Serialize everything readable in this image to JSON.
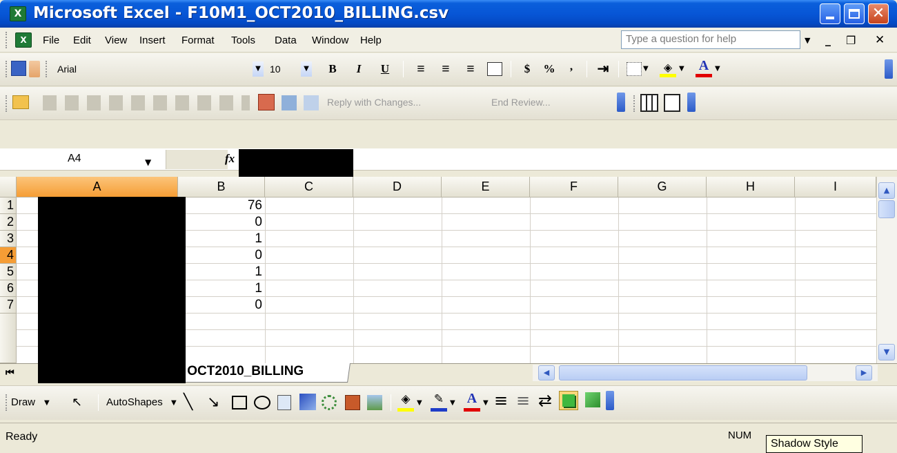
{
  "window": {
    "title": "Microsoft Excel - F10M1_OCT2010_BILLING.csv"
  },
  "menubar": {
    "items": [
      "File",
      "Edit",
      "View",
      "Insert",
      "Format",
      "Tools",
      "Data",
      "Window",
      "Help"
    ],
    "help_placeholder": "Type a question for help"
  },
  "formatting": {
    "font": "Arial",
    "size": "10",
    "bold": "B",
    "italic": "I",
    "underline": "U",
    "currency": "$",
    "percent": "%",
    "comma": ","
  },
  "reviewing": {
    "reply": "Reply with Changes...",
    "end_review": "End Review..."
  },
  "formula_bar": {
    "name_box": "A4",
    "fx": "fx"
  },
  "grid": {
    "columns": [
      "A",
      "B",
      "C",
      "D",
      "E",
      "F",
      "G",
      "H",
      "I"
    ],
    "selected_column": "A",
    "rows": [
      "1",
      "2",
      "3",
      "4",
      "5",
      "6",
      "7"
    ],
    "selected_row": "4",
    "column_b_values": [
      "76",
      "0",
      "1",
      "0",
      "1",
      "1",
      "0"
    ]
  },
  "sheet": {
    "tab_name": "OCT2010_BILLING"
  },
  "drawing": {
    "draw_label": "Draw",
    "autoshapes_label": "AutoShapes"
  },
  "status": {
    "ready": "Ready",
    "num": "NUM",
    "tooltip": "Shadow Style"
  }
}
